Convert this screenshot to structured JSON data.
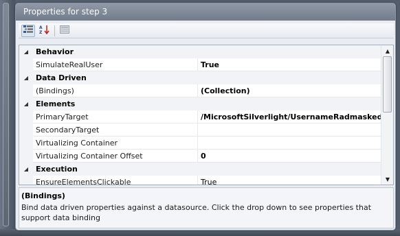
{
  "panel": {
    "title": "Properties for step 3"
  },
  "toolbar": {
    "categorized_icon": "categorized-icon",
    "alphabetical_icon": "alphabetical-icon",
    "property_pages_icon": "property-pages-icon"
  },
  "grid": {
    "rows": [
      {
        "type": "category",
        "label": "Behavior"
      },
      {
        "type": "property",
        "name": "SimulateRealUser",
        "value": "True",
        "bold": true
      },
      {
        "type": "category",
        "label": "Data Driven"
      },
      {
        "type": "property",
        "name": "(Bindings)",
        "value": "(Collection)",
        "bold": true
      },
      {
        "type": "category",
        "label": "Elements"
      },
      {
        "type": "property",
        "name": "PrimaryTarget",
        "value": "/MicrosoftSilverlight/UsernameRadmaskedtex",
        "bold": true
      },
      {
        "type": "property",
        "name": "SecondaryTarget",
        "value": "",
        "bold": false
      },
      {
        "type": "property",
        "name": "Virtualizing Container",
        "value": "",
        "bold": false
      },
      {
        "type": "property",
        "name": "Virtualizing Container Offset",
        "value": "0",
        "bold": true
      },
      {
        "type": "category",
        "label": "Execution"
      },
      {
        "type": "property",
        "name": "EnsureElementsClickable",
        "value": "True",
        "bold": false
      }
    ]
  },
  "description": {
    "title": "(Bindings)",
    "text": "Bind data driven properties against a datasource. Click the drop down to see properties that support data binding"
  }
}
